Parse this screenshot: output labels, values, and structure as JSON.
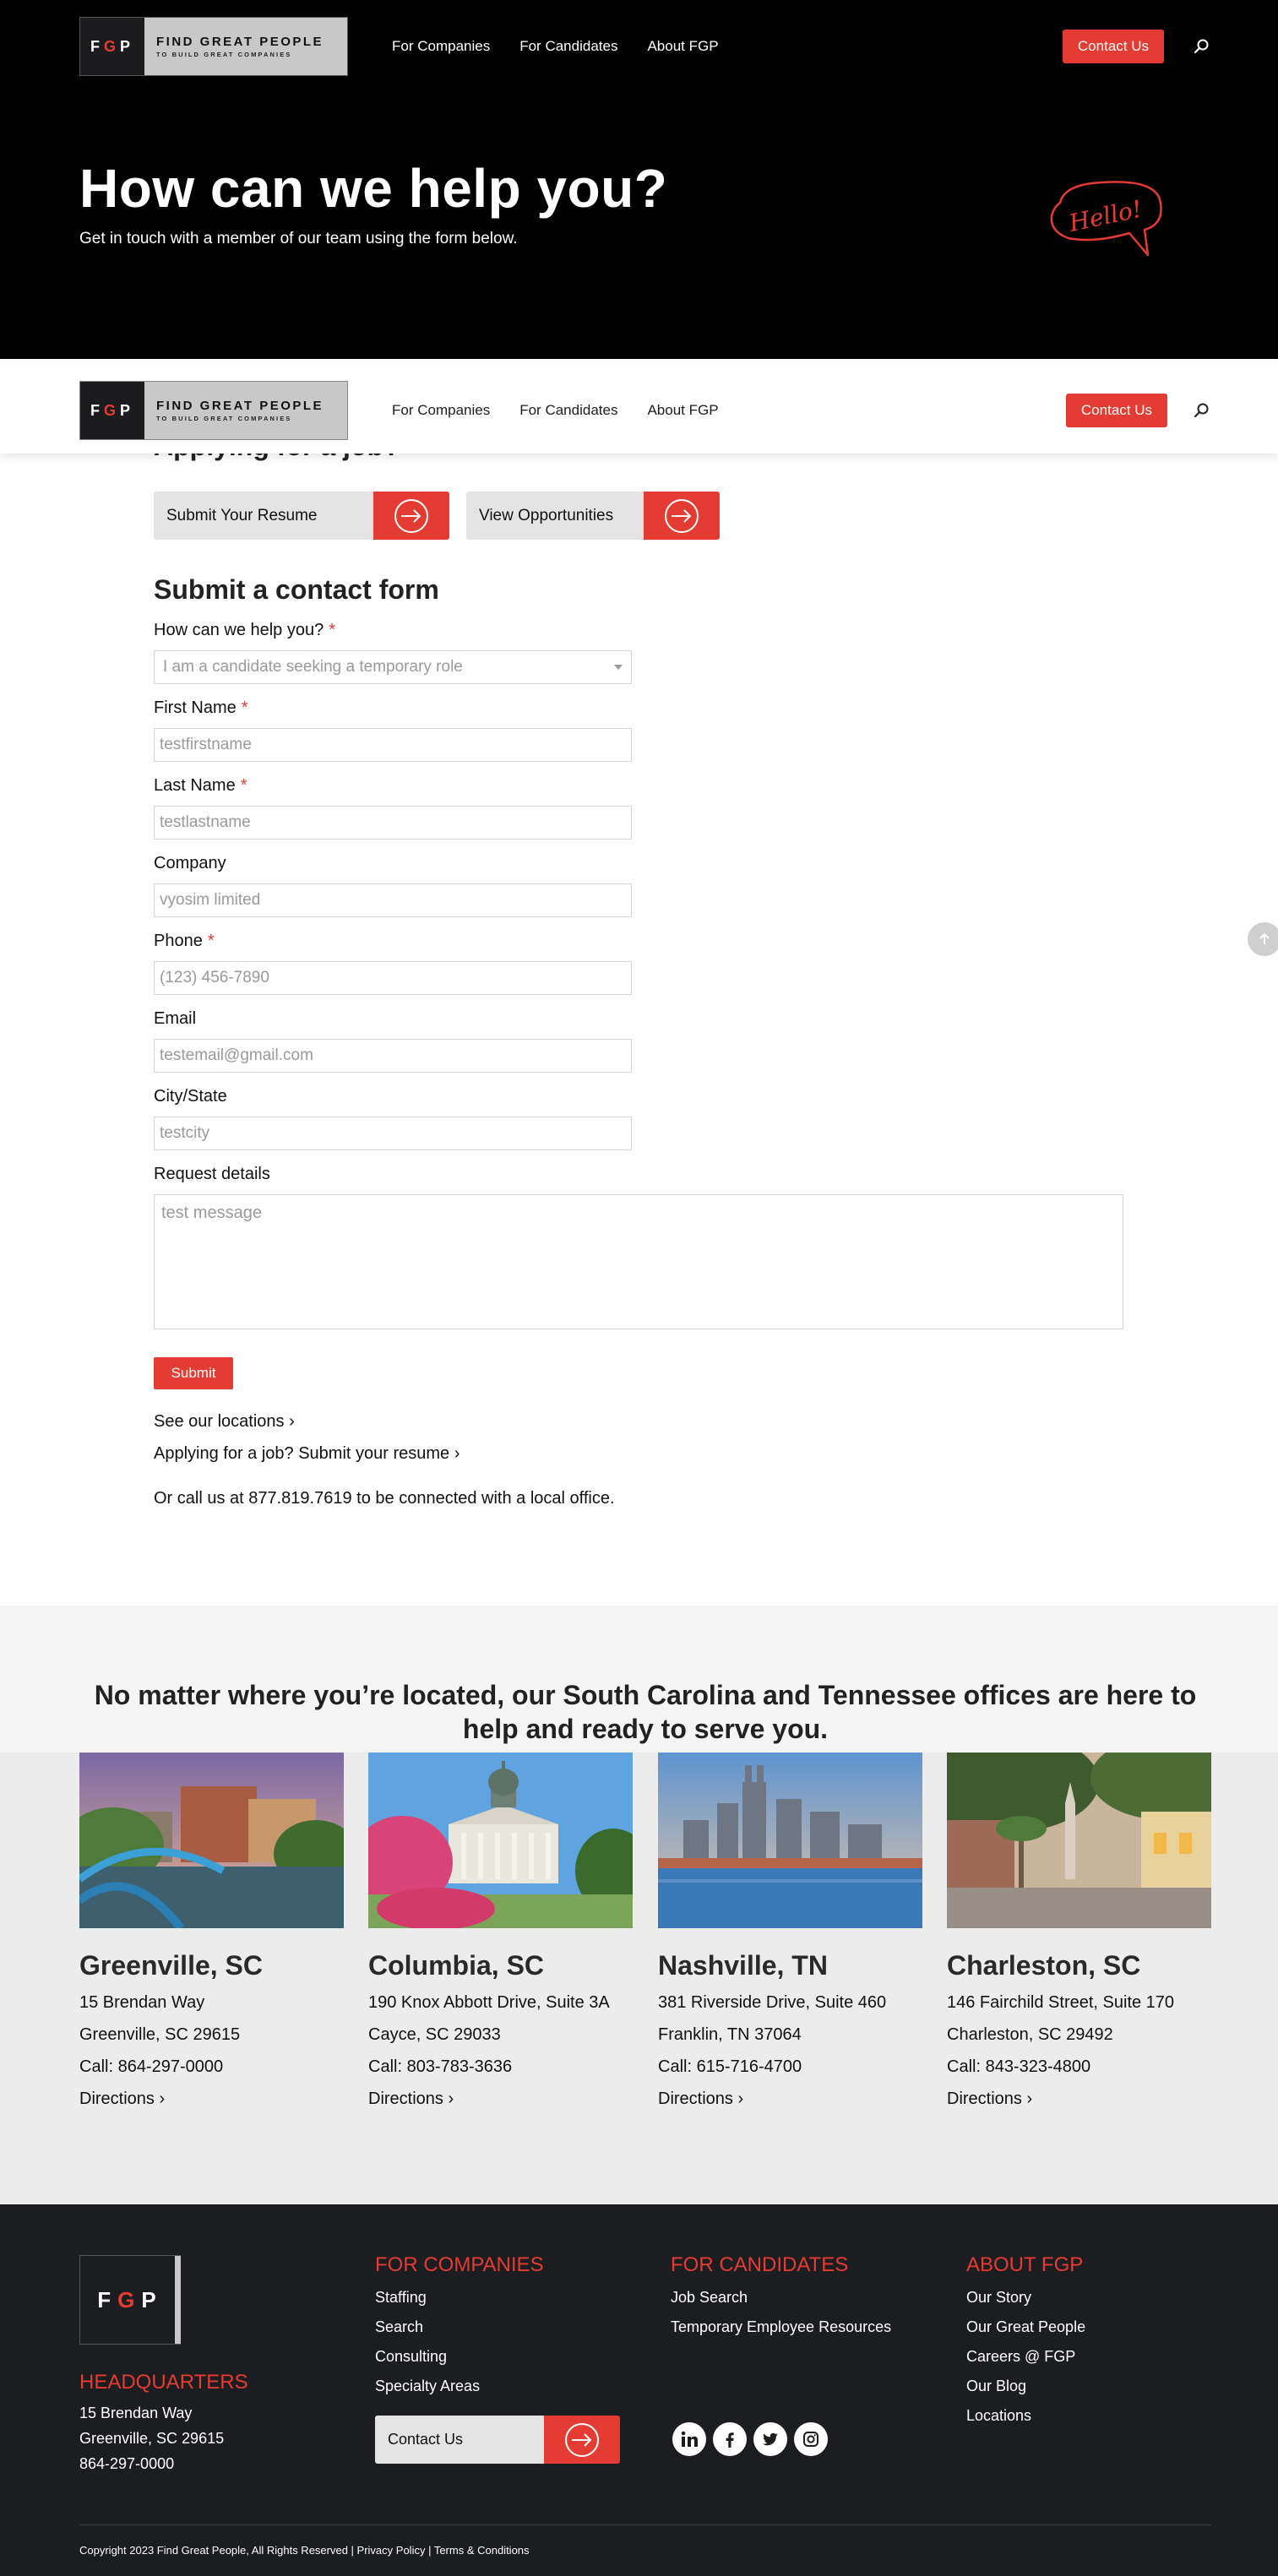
{
  "brand": {
    "logo_letters": "FGP",
    "tagline_1": "FIND GREAT PEOPLE",
    "tagline_2": "TO BUILD GREAT COMPANIES"
  },
  "nav": {
    "links": [
      "For Companies",
      "For Candidates",
      "About FGP"
    ],
    "contact_label": "Contact Us"
  },
  "hero": {
    "title": "How can we help you?",
    "subtitle": "Get in touch with a member of our team using the form below.",
    "hello_text": "Hello!"
  },
  "form_section": {
    "peek_heading": "Applying for a job?",
    "cta_resume": "Submit Your Resume",
    "cta_opportunities": "View Opportunities",
    "heading": "Submit a contact form",
    "help_label": "How can we help you?",
    "help_value": "I am a candidate seeking a temporary role",
    "first_name_label": "First Name",
    "first_name_value": "testfirstname",
    "last_name_label": "Last Name",
    "last_name_value": "testlastname",
    "company_label": "Company",
    "company_value": "vyosim limited",
    "phone_label": "Phone",
    "phone_value": "(123) 456-7890",
    "email_label": "Email",
    "email_value": "testemail@gmail.com",
    "city_label": "City/State",
    "city_value": "testcity",
    "details_label": "Request details",
    "details_value": "test message",
    "required_mark": "*",
    "submit_label": "Submit",
    "link_locations": "See our locations ›",
    "link_resume": "Applying for a job? Submit your resume ›",
    "call_text": "Or call us at 877.819.7619 to be connected with a local office."
  },
  "locations": {
    "heading": "No matter where you’re located, our South Carolina and Tennessee offices are here to help and ready to serve you.",
    "cards": [
      {
        "city": "Greenville, SC",
        "line1": "15 Brendan Way",
        "line2": "Greenville, SC 29615",
        "phone": "Call: 864-297-0000",
        "link": "Directions ›"
      },
      {
        "city": "Columbia, SC",
        "line1": "190 Knox Abbott Drive, Suite 3A",
        "line2": "Cayce, SC 29033",
        "phone": "Call: 803-783-3636",
        "link": "Directions ›"
      },
      {
        "city": "Nashville, TN",
        "line1": "381 Riverside Drive, Suite 460",
        "line2": "Franklin, TN 37064",
        "phone": "Call: 615-716-4700",
        "link": "Directions ›"
      },
      {
        "city": "Charleston, SC",
        "line1": "146 Fairchild Street, Suite 170",
        "line2": "Charleston, SC 29492",
        "phone": "Call: 843-323-4800",
        "link": "Directions ›"
      }
    ]
  },
  "footer": {
    "hq_heading": "HEADQUARTERS",
    "hq_lines": [
      "15 Brendan Way",
      "Greenville, SC 29615",
      "864-297-0000"
    ],
    "companies_heading": "FOR COMPANIES",
    "companies_links": [
      "Staffing",
      "Search",
      "Consulting",
      "Specialty Areas"
    ],
    "candidates_heading": "FOR CANDIDATES",
    "candidates_links": [
      "Job Search",
      "Temporary Employee Resources"
    ],
    "about_heading": "ABOUT FGP",
    "about_links": [
      "Our Story",
      "Our Great People",
      "Careers @ FGP",
      "Our Blog",
      "Locations"
    ],
    "contact_label": "Contact Us",
    "copyright": "Copyright 2023 Find Great People, All Rights Reserved | Privacy Policy | Terms & Conditions"
  },
  "colors": {
    "accent": "#e43b32",
    "hero_bg": "#000000",
    "footer_bg": "#1c1d20"
  }
}
